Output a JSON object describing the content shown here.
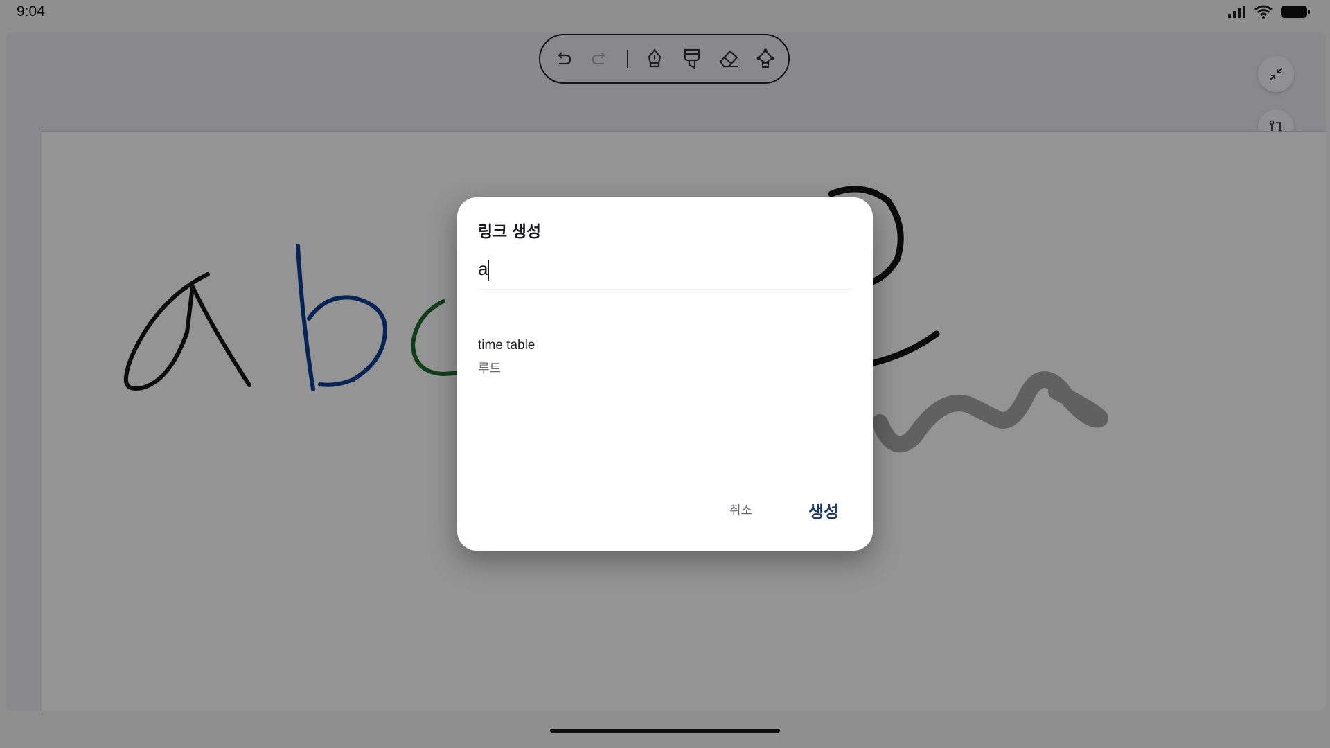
{
  "status_bar": {
    "time": "9:04",
    "icons": [
      "cellular-signal-icon",
      "wifi-icon",
      "battery-icon"
    ]
  },
  "toolbar": {
    "tools": [
      "undo-icon",
      "redo-icon",
      "pen-icon",
      "highlighter-icon",
      "eraser-icon",
      "lasso-icon"
    ]
  },
  "side_buttons": [
    "collapse-icon",
    "swap-icon",
    "book-icon"
  ],
  "canvas": {
    "stroke_colors": {
      "a": "#151515",
      "b": "#0e3f95",
      "c": "#1c6b2c",
      "e": "#151515",
      "squiggle": "#a8a8a8"
    }
  },
  "dialog": {
    "title": "링크 생성",
    "input_value": "a",
    "suggestion": {
      "title": "time table",
      "subtitle": "루트"
    },
    "cancel_label": "취소",
    "create_label": "생성",
    "accent_color": "#1c3a6b"
  }
}
